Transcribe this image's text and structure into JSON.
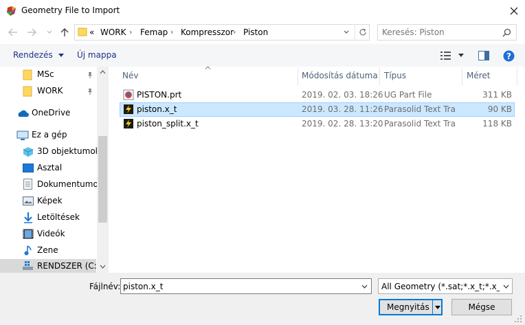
{
  "window": {
    "title": "Geometry File to Import",
    "title_icon": "femap-app-icon",
    "close_icon": "close-icon"
  },
  "nav": {
    "back_icon": "back-arrow-icon",
    "forward_icon": "forward-arrow-icon",
    "recent_icon": "chevron-down-icon",
    "up_icon": "up-arrow-icon",
    "overflow": "«",
    "breadcrumbs": [
      "WORK",
      "Femap",
      "Kompresszor",
      "Piston"
    ],
    "refresh_icon": "refresh-icon",
    "search_placeholder": "Keresés: Piston"
  },
  "toolbar": {
    "organize_label": "Rendezés",
    "new_folder_label": "Új mappa"
  },
  "sidebar": {
    "items": [
      {
        "label": "MSc",
        "icon": "folder-icon",
        "pinned": true
      },
      {
        "label": "WORK",
        "icon": "folder-icon",
        "pinned": true
      },
      {
        "label": "OneDrive",
        "icon": "onedrive-icon"
      },
      {
        "label": "Ez a gép",
        "icon": "computer-icon"
      },
      {
        "label": "3D objektumok",
        "icon": "3d-objects-icon"
      },
      {
        "label": "Asztal",
        "icon": "desktop-icon"
      },
      {
        "label": "Dokumentumok",
        "icon": "documents-icon"
      },
      {
        "label": "Képek",
        "icon": "pictures-icon"
      },
      {
        "label": "Letöltések",
        "icon": "downloads-icon"
      },
      {
        "label": "Videók",
        "icon": "videos-icon"
      },
      {
        "label": "Zene",
        "icon": "music-icon"
      },
      {
        "label": "RENDSZER (C:)",
        "icon": "drive-icon",
        "selected": true
      }
    ]
  },
  "files": {
    "columns": [
      "Név",
      "Módosítás dátuma",
      "Típus",
      "Méret"
    ],
    "rows": [
      {
        "name": "PISTON.prt",
        "date": "2019. 02. 03. 18:26",
        "type": "UG Part File",
        "size": "311 KB",
        "icon": "ug-part-file-icon"
      },
      {
        "name": "piston.x_t",
        "date": "2019. 03. 28. 11:26",
        "type": "Parasolid Text Tra...",
        "size": "90 KB",
        "icon": "parasolid-file-icon",
        "selected": true
      },
      {
        "name": "piston_split.x_t",
        "date": "2019. 02. 28. 13:20",
        "type": "Parasolid Text Tra...",
        "size": "118 KB",
        "icon": "parasolid-file-icon"
      }
    ]
  },
  "bottom": {
    "filename_label": "Fájlnév:",
    "filename_value": "piston.x_t",
    "filter_value": "All Geometry (*.sat;*.x_t;*.x_b;*.igs",
    "open_label": "Megnyitás",
    "cancel_label": "Mégse"
  },
  "colors": {
    "selection_bg": "#cce8ff",
    "selection_border": "#99d1ff",
    "accent": "#0078d7",
    "link": "#1e3287"
  }
}
